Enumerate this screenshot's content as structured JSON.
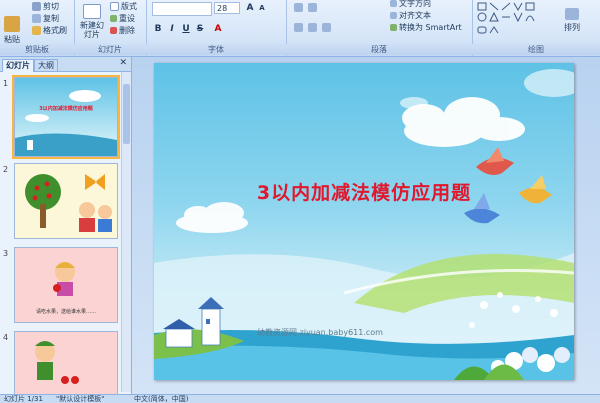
{
  "ribbon": {
    "clipboard": {
      "paste": "粘贴",
      "cut": "剪切",
      "copy": "复制",
      "format_painter": "格式刷",
      "group": "剪贴板"
    },
    "slides": {
      "new_slide": "新建幻灯片",
      "layout": "版式",
      "reset": "重设",
      "delete": "删除",
      "group": "幻灯片"
    },
    "font": {
      "font_size": "28",
      "group": "字体"
    },
    "paragraph": {
      "text_direction": "文字方向",
      "align_text": "对齐文本",
      "smartart": "转换为 SmartArt",
      "group": "段落"
    },
    "drawing": {
      "arrange": "排列",
      "group": "绘图"
    }
  },
  "panel": {
    "tab_slides": "幻灯片",
    "tab_outline": "大纲",
    "slides": [
      {
        "num": "1",
        "title": "3以内加减法模仿应用题"
      },
      {
        "num": "2"
      },
      {
        "num": "3",
        "caption": "请吃水果，送给谁水果……"
      },
      {
        "num": "4"
      }
    ]
  },
  "slide": {
    "title": "3以内加减法模仿应用题",
    "watermark": "幼教资源网 ziyuan.baby611.com"
  },
  "status": {
    "slide_info": "幻灯片 1/31",
    "theme": "\"默认设计模板\"",
    "language": "中文(简体，中国)"
  },
  "colors": {
    "title": "#e0182d",
    "sky": "#5ec2e6",
    "ribbon": "#d5e5f8"
  }
}
